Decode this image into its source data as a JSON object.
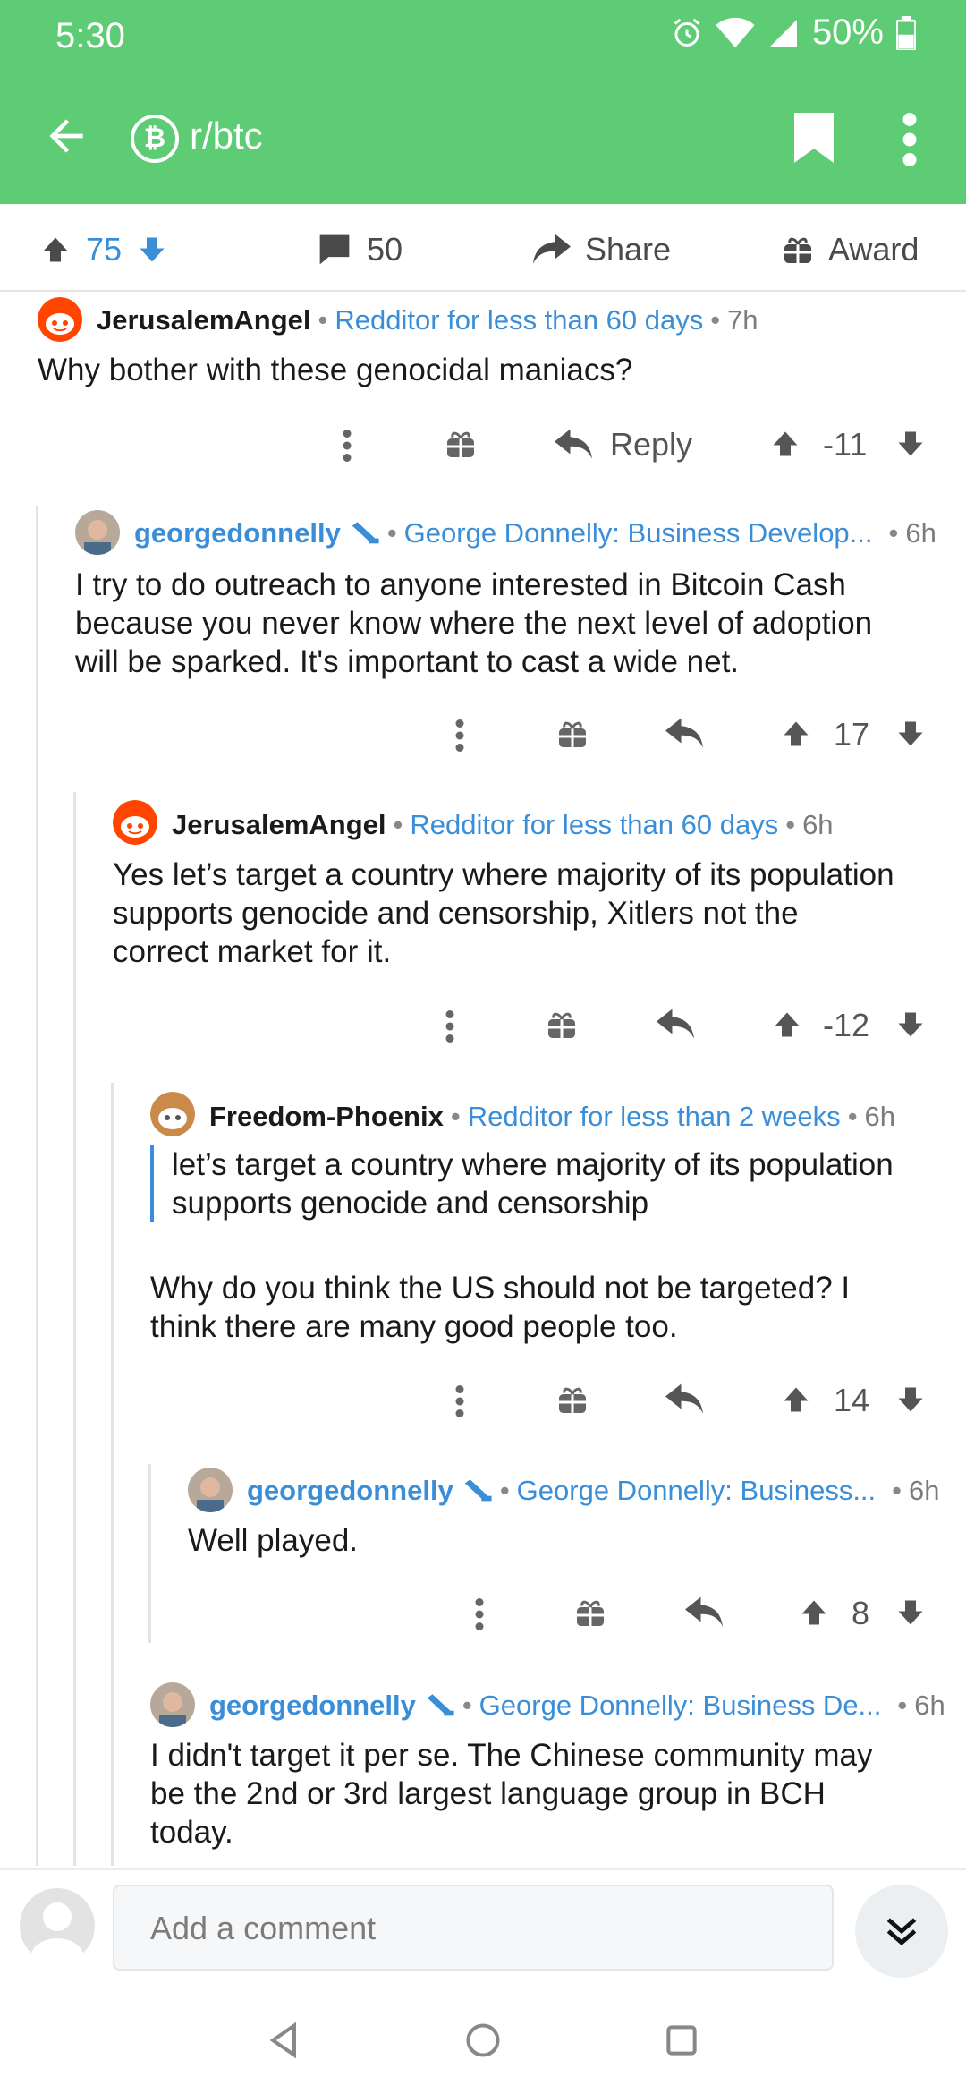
{
  "status_bar": {
    "time": "5:30",
    "battery": "50%"
  },
  "toolbar": {
    "subreddit": "r/btc"
  },
  "post_actions": {
    "upvotes": "75",
    "comments": "50",
    "share_label": "Share",
    "award_label": "Award"
  },
  "comments": [
    {
      "author": "JerusalemAngel",
      "flair": "Redditor for less than 60 days",
      "age": "7h",
      "body": "Why bother with these genocidal maniacs?",
      "reply_label": "Reply",
      "score": "-11"
    },
    {
      "author": "georgedonnelly",
      "flair": "George Donnelly: Business Develop...",
      "age": "6h",
      "body_lines": [
        "I try to do outreach to anyone interested in Bitcoin Cash",
        "because you never know where the next level of adoption",
        "will be sparked. It's important to cast a wide net."
      ],
      "score": "17"
    },
    {
      "author": "JerusalemAngel",
      "flair": "Redditor for less than 60 days",
      "age": "6h",
      "body_lines": [
        "Yes let’s target a country where majority of its population",
        "supports genocide and censorship, Xitlers not the",
        "correct market for it."
      ],
      "score": "-12"
    },
    {
      "author": "Freedom-Phoenix",
      "flair": "Redditor for less than 2 weeks",
      "age": "6h",
      "quote_lines": [
        "let’s target a country where majority of its population",
        "supports genocide and censorship"
      ],
      "body_lines": [
        "Why do you think the US should not be targeted? I",
        "think there are many good people too."
      ],
      "score": "14"
    },
    {
      "author": "georgedonnelly",
      "flair": "George Donnelly: Business...",
      "age": "6h",
      "body": "Well played.",
      "score": "8"
    },
    {
      "author": "georgedonnelly",
      "flair": "George Donnelly: Business De...",
      "age": "6h",
      "body_lines": [
        "I didn't target it per se. The Chinese community may",
        "be the 2nd or 3rd largest language group in BCH",
        "today."
      ]
    }
  ],
  "composer": {
    "placeholder": "Add a comment"
  },
  "colors": {
    "appbar": "#5ECB75",
    "accent": "#3a8ed8"
  }
}
